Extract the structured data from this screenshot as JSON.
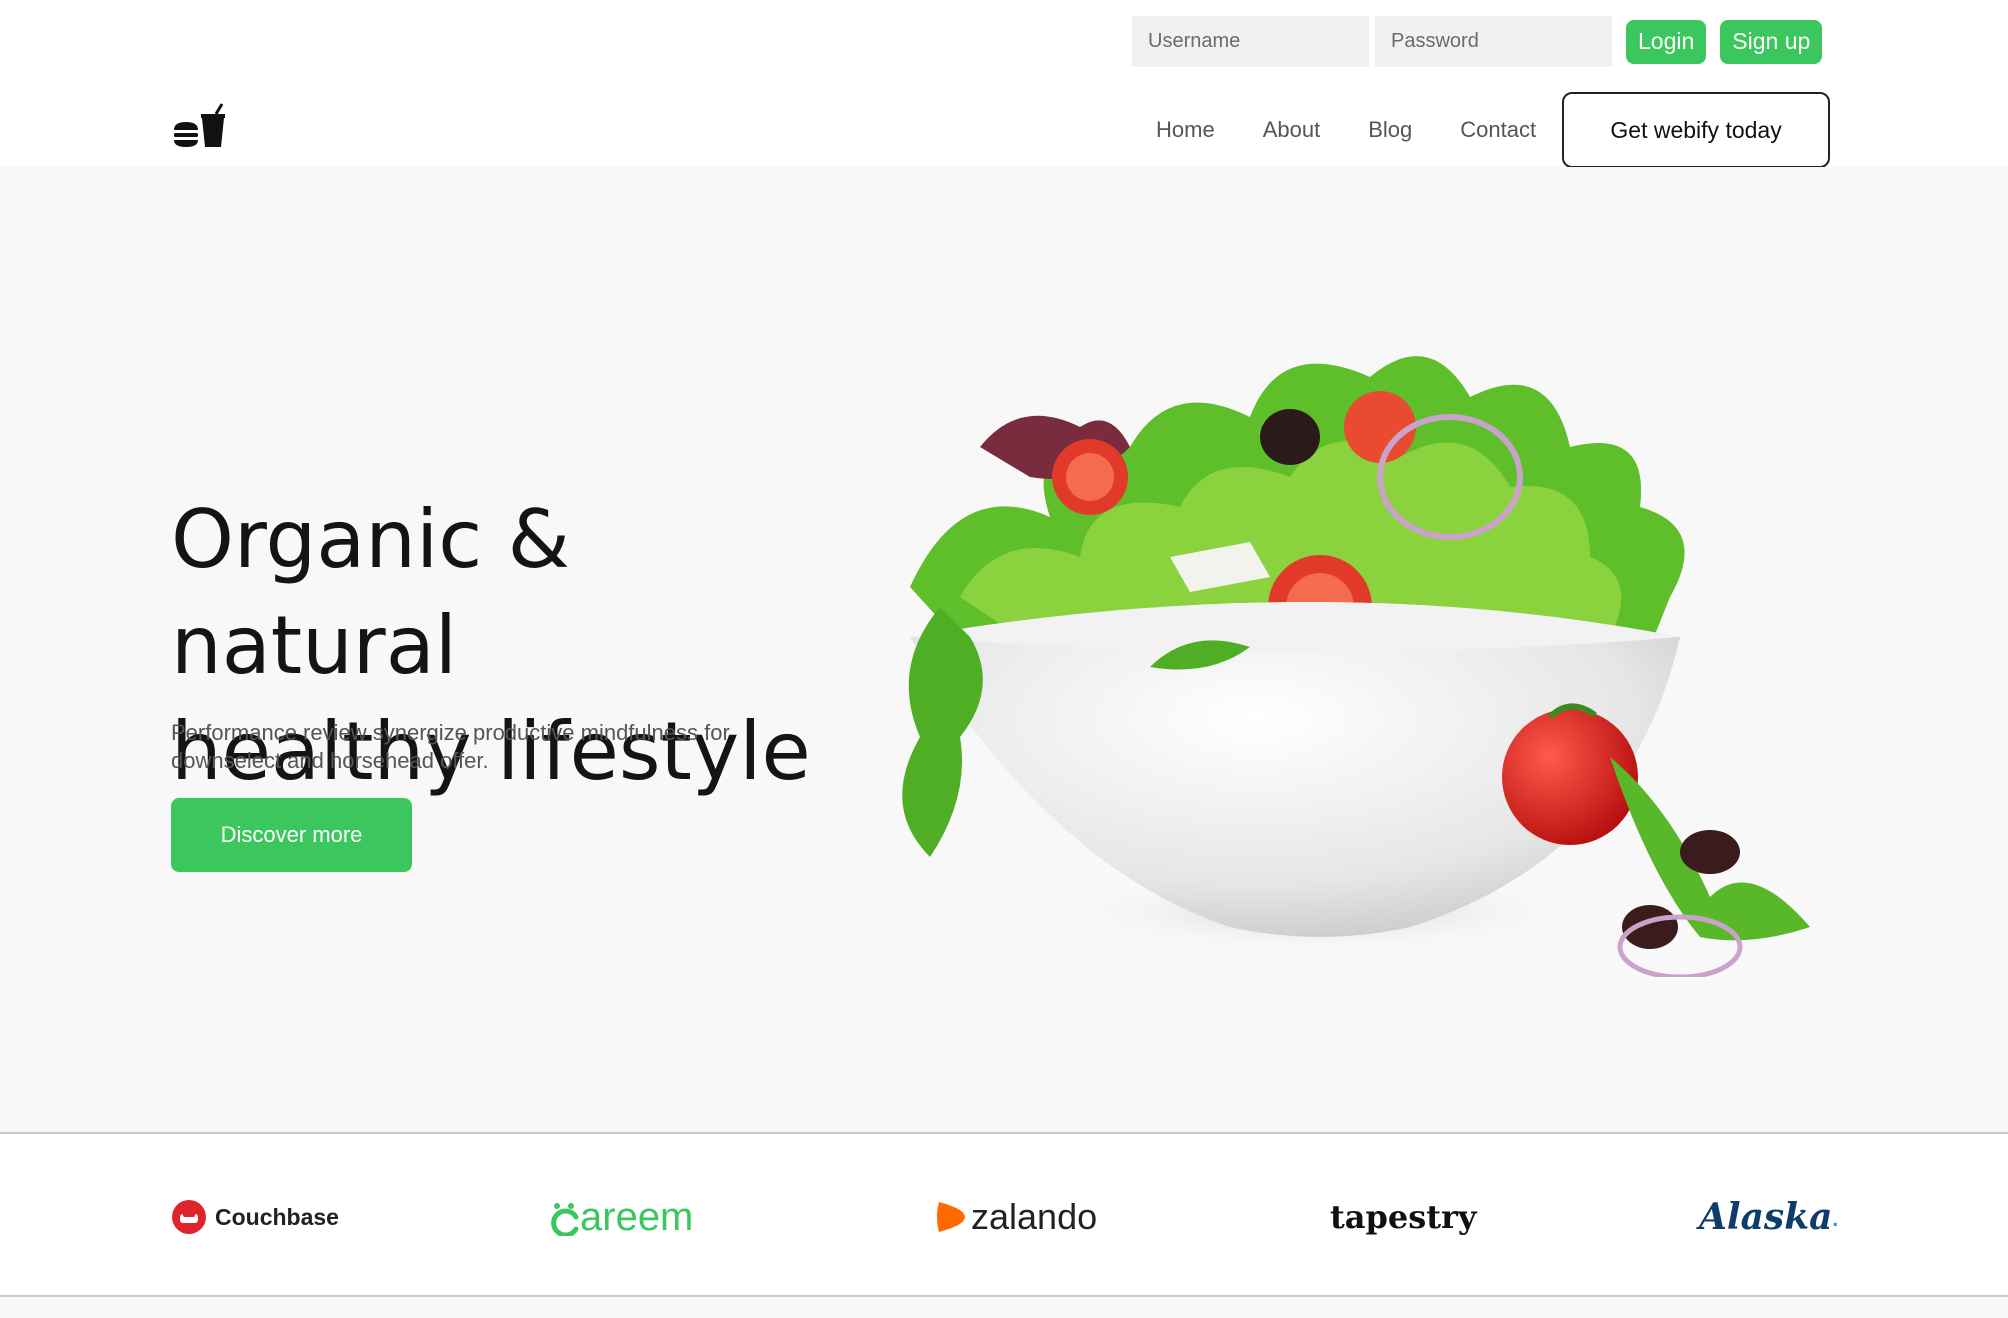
{
  "auth": {
    "username_placeholder": "Username",
    "password_placeholder": "Password",
    "login_label": "Login",
    "signup_label": "Sign up"
  },
  "nav": {
    "items": [
      {
        "label": "Home"
      },
      {
        "label": "About"
      },
      {
        "label": "Blog"
      },
      {
        "label": "Contact"
      }
    ],
    "cta_label": "Get webify today"
  },
  "hero": {
    "title_line1": "Organic & natural",
    "title_line2": "healthy lifestyle",
    "subtitle": "Performance review synergize productive mindfulness for downselect and horsehead offer.",
    "button_label": "Discover more"
  },
  "brands": [
    {
      "name": "Couchbase",
      "color": "#e0242b"
    },
    {
      "name": "areem",
      "color": "#3cc65e"
    },
    {
      "name": "zalando",
      "color": "#ff6900"
    },
    {
      "name": "tapestry",
      "color": "#111111"
    },
    {
      "name": "Alaska",
      "color": "#0f3d6b"
    }
  ],
  "colors": {
    "accent": "#3cc65e",
    "hero_background": "#f8f8f8"
  }
}
